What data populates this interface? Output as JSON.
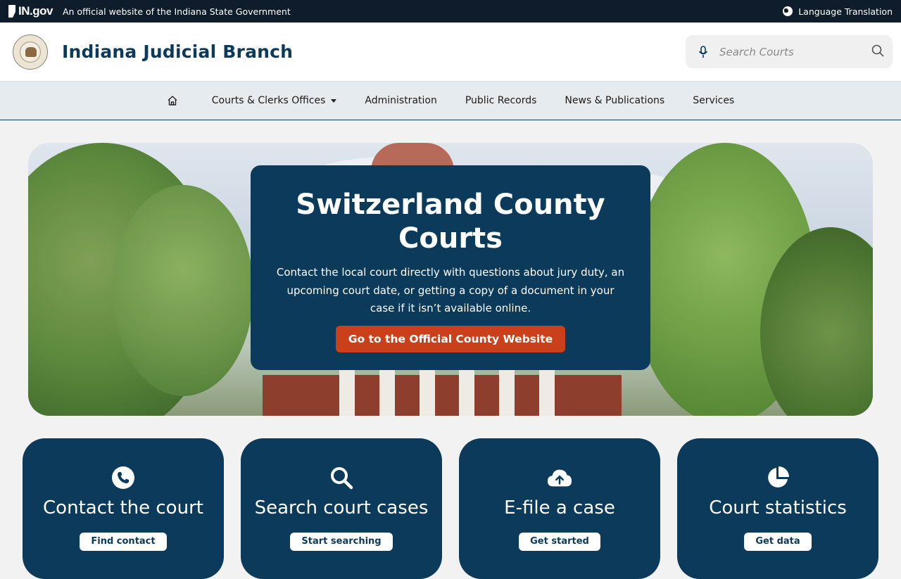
{
  "gov_bar": {
    "logo_text": "IN.gov",
    "official_text": "An official website of the Indiana State Government",
    "language_label": "Language Translation"
  },
  "header": {
    "site_title": "Indiana Judicial Branch",
    "search_placeholder": "Search Courts"
  },
  "nav": {
    "items": [
      {
        "label": "Courts & Clerks Offices",
        "has_dropdown": true
      },
      {
        "label": "Administration"
      },
      {
        "label": "Public Records"
      },
      {
        "label": "News & Publications"
      },
      {
        "label": "Services"
      }
    ]
  },
  "hero": {
    "title": "Switzerland County Courts",
    "text": "Contact the local court directly with questions about jury duty, an upcoming court date, or getting a copy of a document in your case if it isn’t available online.",
    "button_label": "Go to the Official County Website"
  },
  "cards": [
    {
      "title": "Contact the court",
      "icon": "phone-icon",
      "button_label": "Find contact"
    },
    {
      "title": "Search court cases",
      "icon": "search-icon",
      "button_label": "Start searching"
    },
    {
      "title": "E-file a case",
      "icon": "cloud-upload-icon",
      "button_label": "Get started"
    },
    {
      "title": "Court statistics",
      "icon": "pie-chart-icon",
      "button_label": "Get data"
    }
  ],
  "colors": {
    "navy": "#0b3a5b",
    "gov_bar": "#0f1c2b",
    "accent_orange": "#c9401a",
    "nav_bg": "#e6ebef"
  }
}
